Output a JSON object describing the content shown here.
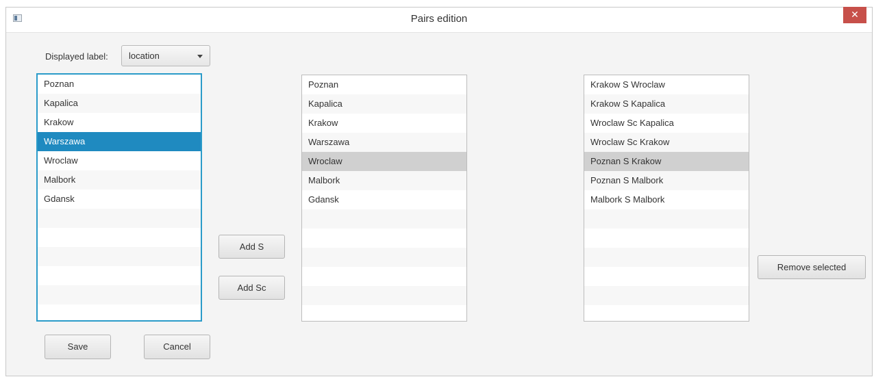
{
  "window": {
    "title": "Pairs edition",
    "close_glyph": "✕"
  },
  "controls": {
    "displayed_label": "Displayed label:",
    "combo_value": "location"
  },
  "left_list": {
    "items": [
      "Poznan",
      "Kapalica",
      "Krakow",
      "Warszawa",
      "Wroclaw",
      "Malbork",
      "Gdansk",
      "",
      "",
      "",
      "",
      "",
      ""
    ],
    "selected_index": 3
  },
  "middle_list": {
    "items": [
      "Poznan",
      "Kapalica",
      "Krakow",
      "Warszawa",
      "Wroclaw",
      "Malbork",
      "Gdansk",
      "",
      "",
      "",
      "",
      "",
      ""
    ],
    "selected_index": 4
  },
  "right_list": {
    "items": [
      "Krakow S Wroclaw",
      "Krakow S Kapalica",
      "Wroclaw Sc Kapalica",
      "Wroclaw Sc Krakow",
      "Poznan S Krakow",
      "Poznan S Malbork",
      "Malbork S Malbork",
      "",
      "",
      "",
      "",
      "",
      ""
    ],
    "selected_index": 4
  },
  "buttons": {
    "add_s": "Add S",
    "add_sc": "Add Sc",
    "remove_selected": "Remove selected",
    "save": "Save",
    "cancel": "Cancel"
  }
}
